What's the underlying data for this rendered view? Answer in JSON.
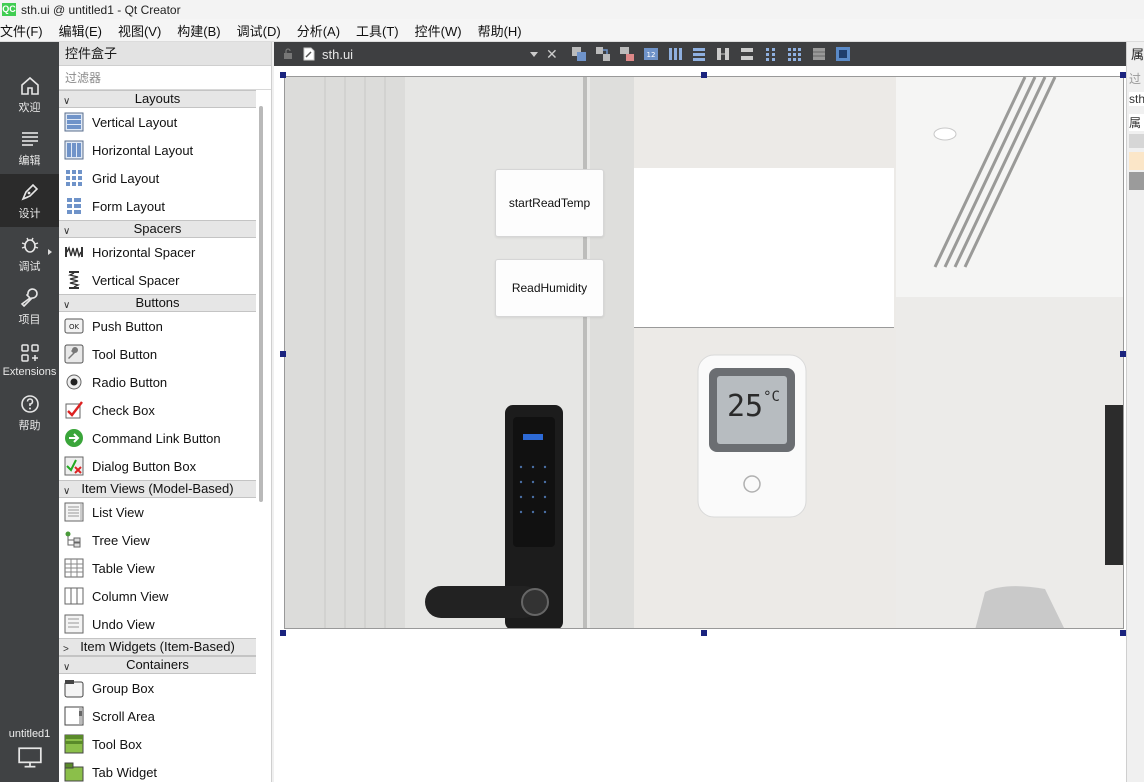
{
  "window": {
    "title": "sth.ui @ untitled1 - Qt Creator",
    "app_icon": "QC"
  },
  "menubar": [
    "文件(F)",
    "编辑(E)",
    "视图(V)",
    "构建(B)",
    "调试(D)",
    "分析(A)",
    "工具(T)",
    "控件(W)",
    "帮助(H)"
  ],
  "modes": [
    {
      "label": "欢迎",
      "icon": "home-icon"
    },
    {
      "label": "编辑",
      "icon": "edit-lines-icon"
    },
    {
      "label": "设计",
      "icon": "pen-icon"
    },
    {
      "label": "调试",
      "icon": "bug-icon"
    },
    {
      "label": "项目",
      "icon": "wrench-icon"
    },
    {
      "label": "Extensions",
      "icon": "extensions-icon"
    },
    {
      "label": "帮助",
      "icon": "help-icon"
    }
  ],
  "kit": {
    "label": "untitled1"
  },
  "widgetbox": {
    "title": "控件盒子",
    "filter_placeholder": "过滤器",
    "categories": {
      "layouts": "Layouts",
      "spacers": "Spacers",
      "buttons": "Buttons",
      "item_views": "Item Views (Model-Based)",
      "item_widgets": "Item Widgets (Item-Based)",
      "containers": "Containers"
    },
    "items": {
      "vertical_layout": "Vertical Layout",
      "horizontal_layout": "Horizontal Layout",
      "grid_layout": "Grid Layout",
      "form_layout": "Form Layout",
      "horizontal_spacer": "Horizontal Spacer",
      "vertical_spacer": "Vertical Spacer",
      "push_button": "Push Button",
      "tool_button": "Tool Button",
      "radio_button": "Radio Button",
      "check_box": "Check Box",
      "command_link_button": "Command Link Button",
      "dialog_button_box": "Dialog Button Box",
      "list_view": "List View",
      "tree_view": "Tree View",
      "table_view": "Table View",
      "column_view": "Column View",
      "undo_view": "Undo View",
      "group_box": "Group Box",
      "scroll_area": "Scroll Area",
      "tool_box": "Tool Box",
      "tab_widget": "Tab Widget"
    }
  },
  "editor": {
    "document": "sth.ui",
    "form_buttons": {
      "start_read_temp": "startReadTemp",
      "read_humidity": "ReadHumidity"
    },
    "device_display": {
      "value": "25",
      "unit": "°C"
    }
  },
  "rightpanel": {
    "title": "属",
    "rows": [
      "过",
      "sth",
      "属"
    ]
  },
  "colors": {
    "modebar": "#404244",
    "toolbar": "#3e3f41",
    "handle": "#1a237e",
    "qt_green": "#41cd52"
  }
}
